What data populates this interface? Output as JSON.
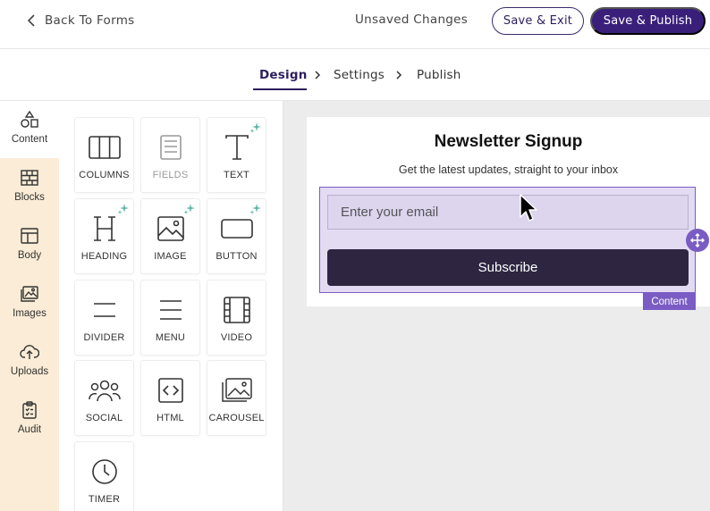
{
  "header": {
    "back_label": "Back To Forms",
    "status_text": "Unsaved Changes",
    "save_exit_label": "Save & Exit",
    "save_publish_label": "Save & Publish"
  },
  "steps": {
    "design": "Design",
    "settings": "Settings",
    "publish": "Publish",
    "active": "Design"
  },
  "rail": {
    "items": [
      {
        "label": "Content",
        "icon": "shapes-icon",
        "active": true
      },
      {
        "label": "Blocks",
        "icon": "bricks-icon"
      },
      {
        "label": "Body",
        "icon": "layout-icon"
      },
      {
        "label": "Images",
        "icon": "images-icon"
      },
      {
        "label": "Uploads",
        "icon": "cloud-upload-icon"
      },
      {
        "label": "Audit",
        "icon": "clipboard-check-icon"
      }
    ]
  },
  "tools": {
    "items": [
      {
        "label": "COLUMNS",
        "icon": "columns-icon"
      },
      {
        "label": "FIELDS",
        "icon": "fields-icon",
        "disabled": true
      },
      {
        "label": "TEXT",
        "icon": "text-icon",
        "ai": true
      },
      {
        "label": "HEADING",
        "icon": "heading-icon",
        "ai": true
      },
      {
        "label": "IMAGE",
        "icon": "image-icon",
        "ai": true
      },
      {
        "label": "BUTTON",
        "icon": "button-icon",
        "ai": true
      },
      {
        "label": "DIVIDER",
        "icon": "divider-icon"
      },
      {
        "label": "MENU",
        "icon": "menu-icon"
      },
      {
        "label": "VIDEO",
        "icon": "video-icon"
      },
      {
        "label": "SOCIAL",
        "icon": "social-icon"
      },
      {
        "label": "HTML",
        "icon": "code-icon"
      },
      {
        "label": "CAROUSEL",
        "icon": "carousel-icon"
      },
      {
        "label": "TIMER",
        "icon": "clock-icon"
      }
    ]
  },
  "canvas": {
    "title": "Newsletter Signup",
    "subtitle": "Get the latest updates, straight to your inbox",
    "email_placeholder": "Enter your email",
    "subscribe_label": "Subscribe",
    "selection_tag": "Content"
  },
  "colors": {
    "brand": "#3a1f7a",
    "selection": "#7a5cc4",
    "rail_bg": "#faecd6",
    "subscribe_bg": "#2e2541"
  }
}
